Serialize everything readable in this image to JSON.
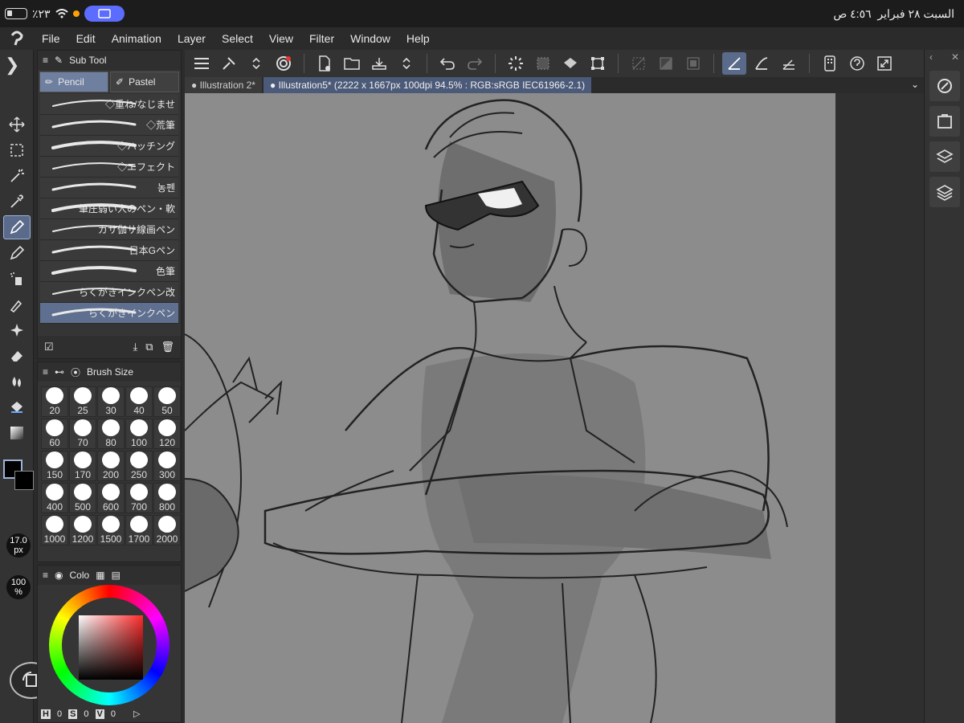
{
  "status_bar": {
    "battery_percent": "٪٢٣",
    "time": "٤:٥٦ ص",
    "date": "السبت ٢٨ فبراير"
  },
  "menu": [
    "File",
    "Edit",
    "Animation",
    "Layer",
    "Select",
    "View",
    "Filter",
    "Window",
    "Help"
  ],
  "sub_tool_panel": {
    "title": "Sub Tool",
    "tabs": [
      "Pencil",
      "Pastel"
    ],
    "brushes": [
      "◇重ね/なじませ",
      "◇荒筆",
      "◇ハッチング",
      "◇エフェクト",
      "농펜",
      "筆圧弱い人のペン・軟",
      "ガサ伽サ線画ペン",
      "日本Gペン",
      "色筆",
      "らくがきインクペン改",
      "らくがきインクペン"
    ],
    "selected_brush": "らくがきインクペン"
  },
  "brush_size_panel": {
    "title": "Brush Size",
    "sizes": [
      "20",
      "25",
      "30",
      "40",
      "50",
      "60",
      "70",
      "80",
      "100",
      "120",
      "150",
      "170",
      "200",
      "250",
      "300",
      "400",
      "500",
      "600",
      "700",
      "800",
      "1000",
      "1200",
      "1500",
      "1700",
      "2000"
    ]
  },
  "color_panel": {
    "title": "Colo",
    "h_label": "H",
    "h_value": "0",
    "s_label": "S",
    "s_value": "0",
    "v_label": "V",
    "v_value": "0"
  },
  "indicators": {
    "brush_size": "17.0",
    "brush_unit": "px",
    "opacity": "100",
    "opacity_unit": "%"
  },
  "tabs": [
    {
      "label": "Illustration 2*"
    },
    {
      "label": "Illustration5* (2222 x 1667px 100dpi 94.5% : RGB:sRGB IEC61966-2.1)"
    }
  ],
  "colors": {
    "accent": "#5a6a8a",
    "canvas": "#8c8c8c",
    "fg": "#000000"
  }
}
